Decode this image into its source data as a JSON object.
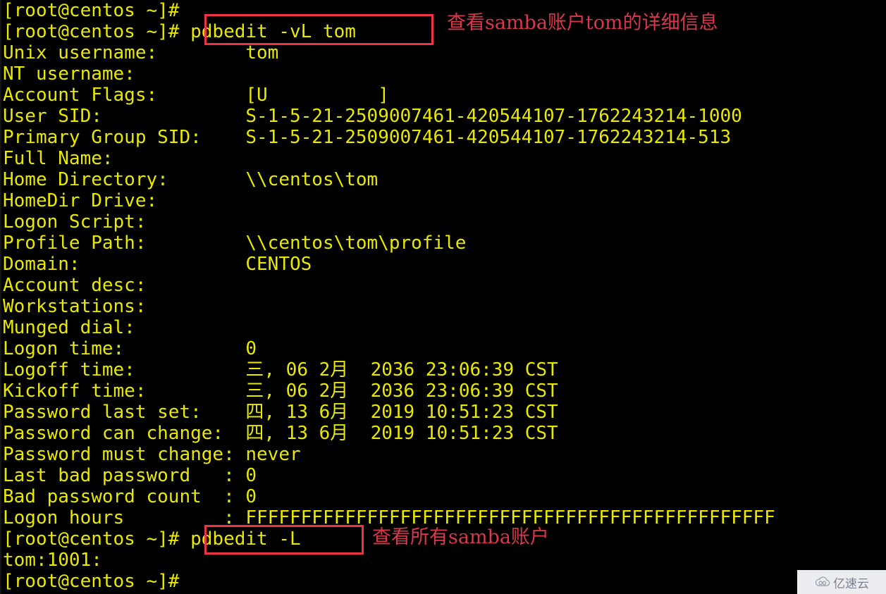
{
  "terminal": {
    "prompt": "[root@centos ~]#",
    "lines": [
      {
        "id": "l0",
        "text": "[root@centos ~]#"
      },
      {
        "id": "l1",
        "text": "[root@centos ~]# pdbedit -vL tom"
      },
      {
        "id": "l2",
        "text": "Unix username:        tom"
      },
      {
        "id": "l3",
        "text": "NT username:"
      },
      {
        "id": "l4",
        "text": "Account Flags:        [U          ]"
      },
      {
        "id": "l5",
        "text": "User SID:             S-1-5-21-2509007461-420544107-1762243214-1000"
      },
      {
        "id": "l6",
        "text": "Primary Group SID:    S-1-5-21-2509007461-420544107-1762243214-513"
      },
      {
        "id": "l7",
        "text": "Full Name:"
      },
      {
        "id": "l8",
        "text": "Home Directory:       \\\\centos\\tom"
      },
      {
        "id": "l9",
        "text": "HomeDir Drive:"
      },
      {
        "id": "l10",
        "text": "Logon Script:"
      },
      {
        "id": "l11",
        "text": "Profile Path:         \\\\centos\\tom\\profile"
      },
      {
        "id": "l12",
        "text": "Domain:               CENTOS"
      },
      {
        "id": "l13",
        "text": "Account desc:"
      },
      {
        "id": "l14",
        "text": "Workstations:"
      },
      {
        "id": "l15",
        "text": "Munged dial:"
      },
      {
        "id": "l16",
        "text": "Logon time:           0"
      },
      {
        "id": "l17",
        "text": "Logoff time:          三, 06 2月  2036 23:06:39 CST"
      },
      {
        "id": "l18",
        "text": "Kickoff time:         三, 06 2月  2036 23:06:39 CST"
      },
      {
        "id": "l19",
        "text": "Password last set:    四, 13 6月  2019 10:51:23 CST"
      },
      {
        "id": "l20",
        "text": "Password can change:  四, 13 6月  2019 10:51:23 CST"
      },
      {
        "id": "l21",
        "text": "Password must change: never"
      },
      {
        "id": "l22",
        "text": "Last bad password   : 0"
      },
      {
        "id": "l23",
        "text": "Bad password count  : 0"
      },
      {
        "id": "l24",
        "text": "Logon hours         : FFFFFFFFFFFFFFFFFFFFFFFFFFFFFFFFFFFFFFFFFFFFFFFF"
      },
      {
        "id": "l25",
        "text": "[root@centos ~]# pdbedit -L"
      },
      {
        "id": "l26",
        "text": "tom:1001:"
      },
      {
        "id": "l27",
        "text": "[root@centos ~]#"
      }
    ],
    "commands": {
      "command_1": "pdbedit -vL tom",
      "command_2": "pdbedit -L"
    },
    "account": {
      "unix_username": "tom",
      "nt_username": "",
      "account_flags": "[U          ]",
      "user_sid": "S-1-5-21-2509007461-420544107-1762243214-1000",
      "primary_group_sid": "S-1-5-21-2509007461-420544107-1762243214-513",
      "full_name": "",
      "home_directory": "\\\\centos\\tom",
      "homedir_drive": "",
      "logon_script": "",
      "profile_path": "\\\\centos\\tom\\profile",
      "domain": "CENTOS",
      "account_desc": "",
      "workstations": "",
      "munged_dial": "",
      "logon_time": "0",
      "logoff_time": "三, 06 2月  2036 23:06:39 CST",
      "kickoff_time": "三, 06 2月  2036 23:06:39 CST",
      "password_last_set": "四, 13 6月  2019 10:51:23 CST",
      "password_can_change": "四, 13 6月  2019 10:51:23 CST",
      "password_must_change": "never",
      "last_bad_password": "0",
      "bad_password_count": "0",
      "logon_hours": "FFFFFFFFFFFFFFFFFFFFFFFFFFFFFFFFFFFFFFFFFFFFFFFF",
      "listed_account": "tom:1001:"
    }
  },
  "annotations": {
    "note_1": "查看samba账户tom的详细信息",
    "note_2": "查看所有samba账户"
  },
  "watermark": {
    "text": "亿速云"
  },
  "colors": {
    "foreground": "#e8e800",
    "background": "#000000",
    "annotation": "#d9384a",
    "highlight_box": "#ee3344"
  }
}
